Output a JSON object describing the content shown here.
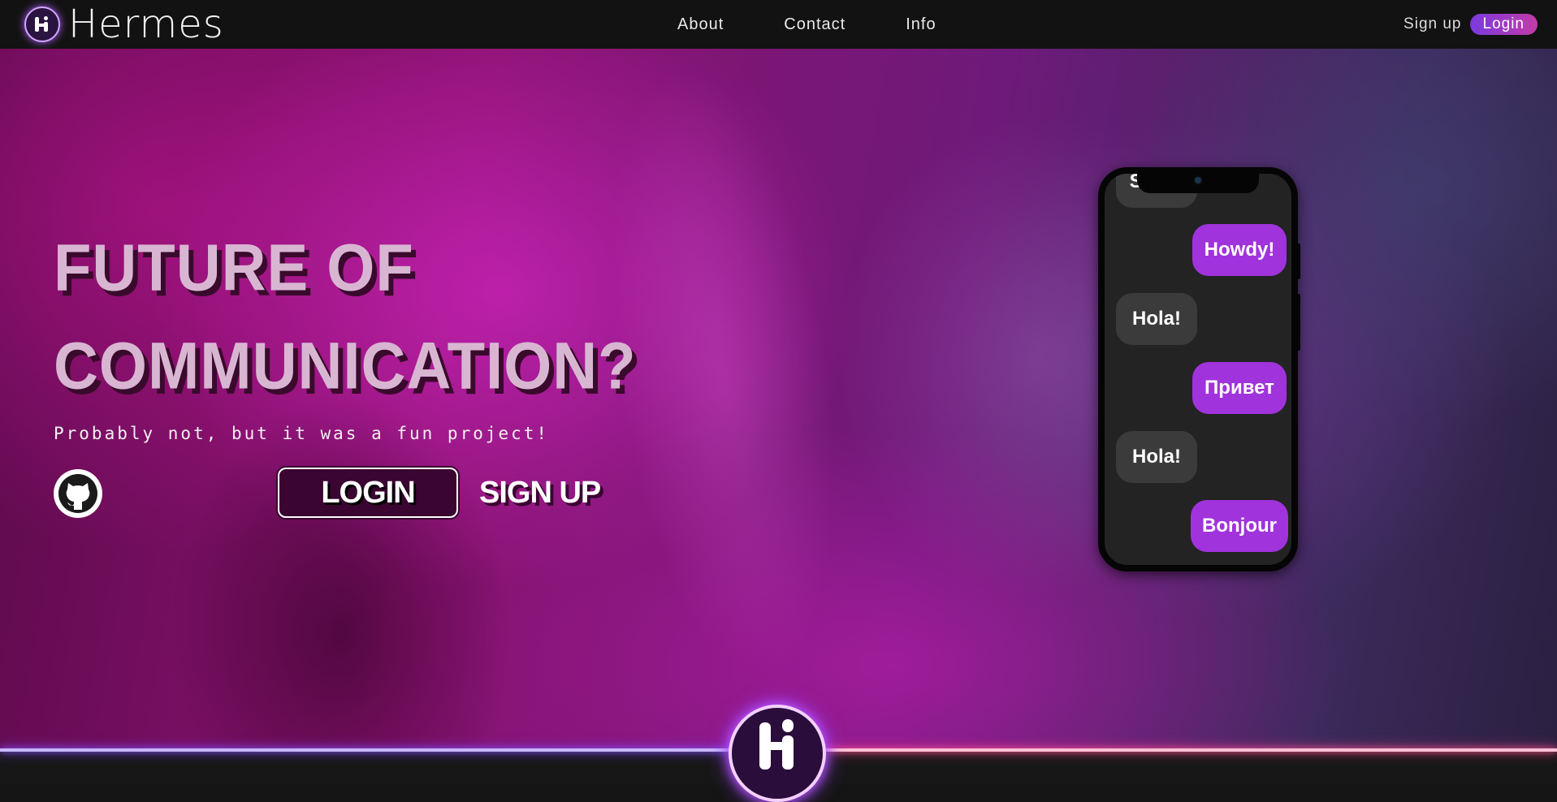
{
  "navbar": {
    "brand": "Hermes",
    "links": [
      {
        "label": "About"
      },
      {
        "label": "Contact"
      },
      {
        "label": "Info"
      }
    ],
    "signup_label": "Sign up",
    "login_label": "Login"
  },
  "hero": {
    "title_line1": "FUTURE OF",
    "title_line2": "COMMUNICATION?",
    "subtitle": "Probably not, but it was a fun project!",
    "login_button": "LOGIN",
    "signup_button": "SIGN UP"
  },
  "phone": {
    "messages": [
      {
        "text": "Salut!",
        "side": "in"
      },
      {
        "text": "Howdy!",
        "side": "out"
      },
      {
        "text": "Hola!",
        "side": "in"
      },
      {
        "text": "Привет",
        "side": "out"
      },
      {
        "text": "Hola!",
        "side": "in"
      },
      {
        "text": "Bonjour",
        "side": "out"
      }
    ]
  },
  "colors": {
    "accent_purple": "#a033dc",
    "bubble_gray": "#3b3b3b",
    "neon_left": "#8b5cff",
    "neon_right": "#ff5c9a"
  },
  "icons": [
    "hermes-logo-icon",
    "github-icon"
  ]
}
